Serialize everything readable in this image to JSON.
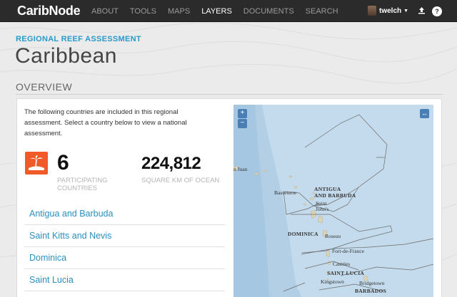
{
  "nav": {
    "brand": "CaribNode",
    "links": [
      "ABOUT",
      "TOOLS",
      "MAPS",
      "LAYERS",
      "DOCUMENTS",
      "SEARCH"
    ],
    "active": "LAYERS",
    "user": "twelch"
  },
  "header": {
    "subtitle": "REGIONAL REEF ASSESSMENT",
    "title": "Caribbean"
  },
  "overview": {
    "heading": "OVERVIEW",
    "intro": "The following countries are included in this regional assessment. Select a country below to view a national assessment.",
    "stats": [
      {
        "value": "6",
        "label": "PARTICIPATING COUNTRIES"
      },
      {
        "value": "224,812",
        "label": "SQUARE KM OF OCEAN"
      }
    ],
    "countries": [
      "Antigua and Barbuda",
      "Saint Kitts and Nevis",
      "Dominica",
      "Saint Lucia"
    ]
  },
  "map": {
    "zoom_in": "+",
    "zoom_out": "−",
    "expand": "↔",
    "labels": {
      "san_juan": "n Juan",
      "basseterre": "Basseterre",
      "antigua": "ANTIGUA",
      "barbuda": "AND BARBUDA",
      "saint": "Saint",
      "johns": "John's",
      "dominica": "DOMINICA",
      "roseau": "Roseau",
      "fortdefrance": "Fort-de-France",
      "castries": "Castries",
      "saintlucia": "SAINT LUCIA",
      "kingstown": "Kingstown",
      "bridgetown": "Bridgetown",
      "barbados": "BARBADOS"
    }
  },
  "colors": {
    "navbar": "#2b2b2b",
    "accent_blue": "#2a9ac8",
    "link_blue": "#2a8fbf",
    "icon_orange": "#f05a28",
    "sea": "#bed6e8"
  },
  "icons": {
    "island": "island-palm-icon",
    "upload": "upload-icon",
    "help": "help-icon"
  }
}
